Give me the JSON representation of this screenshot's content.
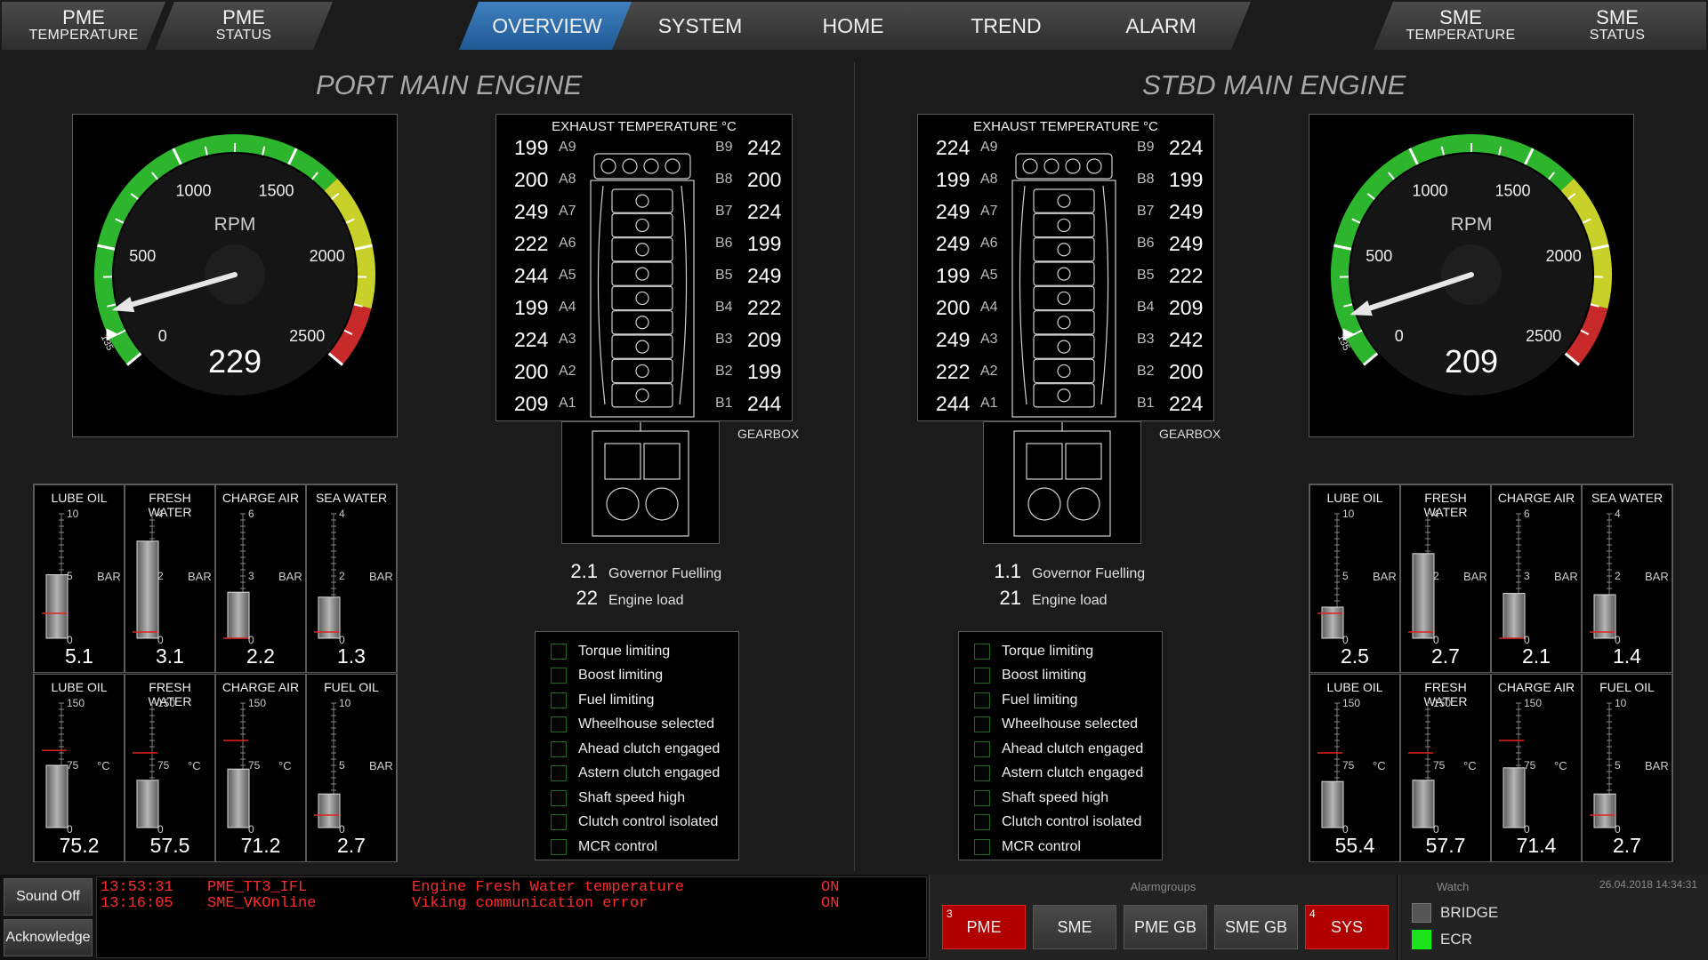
{
  "nav": {
    "left_tabs": [
      {
        "main": "PME",
        "sub": "TEMPERATURE"
      },
      {
        "main": "PME",
        "sub": "STATUS"
      }
    ],
    "center_tabs": [
      "OVERVIEW",
      "SYSTEM",
      "HOME",
      "TREND",
      "ALARM"
    ],
    "active": "OVERVIEW",
    "right_tabs": [
      {
        "main": "SME",
        "sub": "TEMPERATURE"
      },
      {
        "main": "SME",
        "sub": "STATUS"
      }
    ]
  },
  "port": {
    "title": "PORT MAIN ENGINE",
    "gauge": {
      "label": "RPM",
      "value": "229",
      "rpm": 229,
      "setpoint_label": "135",
      "ticks": [
        "0",
        "500",
        "1000",
        "1500",
        "2000",
        "2500"
      ]
    },
    "exhaust": {
      "title": "EXHAUST TEMPERATURE °C",
      "a": [
        {
          "label": "A9",
          "value": "199"
        },
        {
          "label": "A8",
          "value": "200"
        },
        {
          "label": "A7",
          "value": "249"
        },
        {
          "label": "A6",
          "value": "222"
        },
        {
          "label": "A5",
          "value": "244"
        },
        {
          "label": "A4",
          "value": "199"
        },
        {
          "label": "A3",
          "value": "224"
        },
        {
          "label": "A2",
          "value": "200"
        },
        {
          "label": "A1",
          "value": "209"
        }
      ],
      "b": [
        {
          "label": "B9",
          "value": "242"
        },
        {
          "label": "B8",
          "value": "200"
        },
        {
          "label": "B7",
          "value": "224"
        },
        {
          "label": "B6",
          "value": "199"
        },
        {
          "label": "B5",
          "value": "249"
        },
        {
          "label": "B4",
          "value": "222"
        },
        {
          "label": "B3",
          "value": "209"
        },
        {
          "label": "B2",
          "value": "199"
        },
        {
          "label": "B1",
          "value": "244"
        }
      ],
      "gearbox": "GEARBOX"
    },
    "governor": {
      "value": "2.1",
      "label": "Governor Fuelling"
    },
    "load": {
      "value": "22",
      "label": "Engine load"
    },
    "sensors": [
      {
        "title": "LUBE OIL",
        "max": "10",
        "mid": "5",
        "unit": "BAR",
        "value": "5.1",
        "fill": 0.51,
        "alarm": 0.2
      },
      {
        "title": "FRESH WATER",
        "max": "4",
        "mid": "2",
        "unit": "BAR",
        "value": "3.1",
        "fill": 0.78,
        "alarm": 0.05
      },
      {
        "title": "CHARGE AIR",
        "max": "6",
        "mid": "3",
        "unit": "BAR",
        "value": "2.2",
        "fill": 0.37,
        "alarm": 0.0
      },
      {
        "title": "SEA WATER",
        "max": "4",
        "mid": "2",
        "unit": "BAR",
        "value": "1.3",
        "fill": 0.33,
        "alarm": 0.05
      },
      {
        "title": "LUBE OIL",
        "max": "150",
        "mid": "75",
        "unit": "°C",
        "value": "75.2",
        "fill": 0.5,
        "alarm": 0.62
      },
      {
        "title": "FRESH WATER",
        "max": "150",
        "mid": "75",
        "unit": "°C",
        "value": "57.5",
        "fill": 0.38,
        "alarm": 0.6
      },
      {
        "title": "CHARGE AIR",
        "max": "150",
        "mid": "75",
        "unit": "°C",
        "value": "71.2",
        "fill": 0.47,
        "alarm": 0.7
      },
      {
        "title": "FUEL OIL",
        "max": "10",
        "mid": "5",
        "unit": "BAR",
        "value": "2.7",
        "fill": 0.27,
        "alarm": 0.1
      }
    ]
  },
  "stbd": {
    "title": "STBD MAIN ENGINE",
    "gauge": {
      "label": "RPM",
      "value": "209",
      "rpm": 209,
      "setpoint_label": "135",
      "ticks": [
        "0",
        "500",
        "1000",
        "1500",
        "2000",
        "2500"
      ]
    },
    "exhaust": {
      "title": "EXHAUST TEMPERATURE °C",
      "a": [
        {
          "label": "A9",
          "value": "224"
        },
        {
          "label": "A8",
          "value": "199"
        },
        {
          "label": "A7",
          "value": "249"
        },
        {
          "label": "A6",
          "value": "249"
        },
        {
          "label": "A5",
          "value": "199"
        },
        {
          "label": "A4",
          "value": "200"
        },
        {
          "label": "A3",
          "value": "249"
        },
        {
          "label": "A2",
          "value": "222"
        },
        {
          "label": "A1",
          "value": "244"
        }
      ],
      "b": [
        {
          "label": "B9",
          "value": "224"
        },
        {
          "label": "B8",
          "value": "199"
        },
        {
          "label": "B7",
          "value": "249"
        },
        {
          "label": "B6",
          "value": "249"
        },
        {
          "label": "B5",
          "value": "222"
        },
        {
          "label": "B4",
          "value": "209"
        },
        {
          "label": "B3",
          "value": "242"
        },
        {
          "label": "B2",
          "value": "200"
        },
        {
          "label": "B1",
          "value": "224"
        }
      ],
      "gearbox": "GEARBOX"
    },
    "governor": {
      "value": "1.1",
      "label": "Governor Fuelling"
    },
    "load": {
      "value": "21",
      "label": "Engine load"
    },
    "sensors": [
      {
        "title": "LUBE OIL",
        "max": "10",
        "mid": "5",
        "unit": "BAR",
        "value": "2.5",
        "fill": 0.25,
        "alarm": 0.2
      },
      {
        "title": "FRESH WATER",
        "max": "4",
        "mid": "2",
        "unit": "BAR",
        "value": "2.7",
        "fill": 0.68,
        "alarm": 0.05
      },
      {
        "title": "CHARGE AIR",
        "max": "6",
        "mid": "3",
        "unit": "BAR",
        "value": "2.1",
        "fill": 0.36,
        "alarm": 0.0
      },
      {
        "title": "SEA WATER",
        "max": "4",
        "mid": "2",
        "unit": "BAR",
        "value": "1.4",
        "fill": 0.35,
        "alarm": 0.05
      },
      {
        "title": "LUBE OIL",
        "max": "150",
        "mid": "75",
        "unit": "°C",
        "value": "55.4",
        "fill": 0.37,
        "alarm": 0.6
      },
      {
        "title": "FRESH WATER",
        "max": "150",
        "mid": "75",
        "unit": "°C",
        "value": "57.7",
        "fill": 0.38,
        "alarm": 0.6
      },
      {
        "title": "CHARGE AIR",
        "max": "150",
        "mid": "75",
        "unit": "°C",
        "value": "71.4",
        "fill": 0.48,
        "alarm": 0.7
      },
      {
        "title": "FUEL OIL",
        "max": "10",
        "mid": "5",
        "unit": "BAR",
        "value": "2.7",
        "fill": 0.27,
        "alarm": 0.1
      }
    ]
  },
  "status_items": [
    "Torque limiting",
    "Boost limiting",
    "Fuel limiting",
    "Wheelhouse selected",
    "Ahead clutch engaged",
    "Astern clutch engaged",
    "Shaft speed high",
    "Clutch control isolated",
    "MCR control"
  ],
  "bottom": {
    "sound_off": "Sound Off",
    "acknowledge": "Acknowledge",
    "alarms": [
      {
        "time": "13:53:31",
        "tag": "PME_TT3_IFL",
        "text": "Engine Fresh Water temperature",
        "state": "ON"
      },
      {
        "time": "13:16:05",
        "tag": "SME_VKOnline",
        "text": "Viking communication error",
        "state": "ON"
      }
    ],
    "alarmgroups_title": "Alarmgroups",
    "groups": [
      {
        "label": "PME",
        "count": "3",
        "active": true
      },
      {
        "label": "SME",
        "count": "",
        "active": false
      },
      {
        "label": "PME GB",
        "count": "",
        "active": false
      },
      {
        "label": "SME GB",
        "count": "",
        "active": false
      },
      {
        "label": "SYS",
        "count": "4",
        "active": true
      }
    ],
    "watch_title": "Watch",
    "datetime": "26.04.2018   14:34:31",
    "watch": [
      {
        "label": "BRIDGE",
        "on": false
      },
      {
        "label": "ECR",
        "on": true
      }
    ]
  },
  "colors": {
    "accent": "#2a6cb0",
    "green": "#2db52d",
    "yellow": "#c8d02a",
    "red": "#c82a2a",
    "alarm_text": "#ff2a2a"
  }
}
